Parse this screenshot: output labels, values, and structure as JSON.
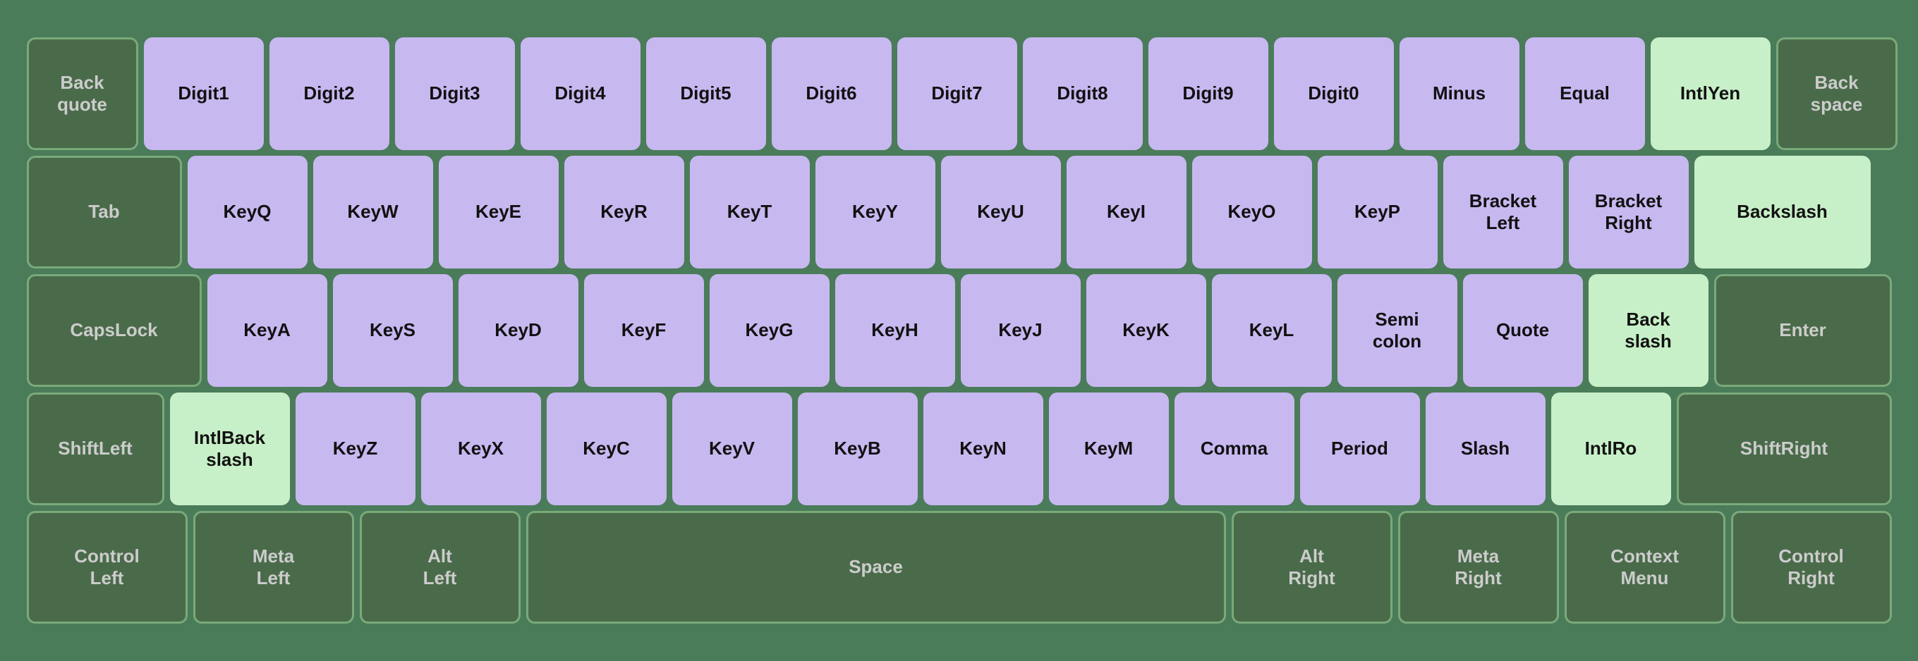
{
  "keyboard": {
    "rows": [
      {
        "id": "row1",
        "keys": [
          {
            "id": "Backquote",
            "label": "Back\nquote",
            "type": "special",
            "size": "r1-backquote"
          },
          {
            "id": "Digit1",
            "label": "Digit1",
            "type": "normal",
            "size": "r1-digit"
          },
          {
            "id": "Digit2",
            "label": "Digit2",
            "type": "normal",
            "size": "r1-digit"
          },
          {
            "id": "Digit3",
            "label": "Digit3",
            "type": "normal",
            "size": "r1-digit"
          },
          {
            "id": "Digit4",
            "label": "Digit4",
            "type": "normal",
            "size": "r1-digit"
          },
          {
            "id": "Digit5",
            "label": "Digit5",
            "type": "normal",
            "size": "r1-digit"
          },
          {
            "id": "Digit6",
            "label": "Digit6",
            "type": "normal",
            "size": "r1-digit"
          },
          {
            "id": "Digit7",
            "label": "Digit7",
            "type": "normal",
            "size": "r1-digit"
          },
          {
            "id": "Digit8",
            "label": "Digit8",
            "type": "normal",
            "size": "r1-digit"
          },
          {
            "id": "Digit9",
            "label": "Digit9",
            "type": "normal",
            "size": "r1-digit"
          },
          {
            "id": "Digit0",
            "label": "Digit0",
            "type": "normal",
            "size": "r1-digit"
          },
          {
            "id": "Minus",
            "label": "Minus",
            "type": "normal",
            "size": "r1-minus"
          },
          {
            "id": "Equal",
            "label": "Equal",
            "type": "normal",
            "size": "r1-equal"
          },
          {
            "id": "IntlYen",
            "label": "IntlYen",
            "type": "highlight",
            "size": "r1-intlyen"
          },
          {
            "id": "Backspace",
            "label": "Back\nspace",
            "type": "special",
            "size": "r1-backspace"
          }
        ]
      },
      {
        "id": "row2",
        "keys": [
          {
            "id": "Tab",
            "label": "Tab",
            "type": "special",
            "size": "r2-tab"
          },
          {
            "id": "KeyQ",
            "label": "KeyQ",
            "type": "normal",
            "size": "r2-key"
          },
          {
            "id": "KeyW",
            "label": "KeyW",
            "type": "normal",
            "size": "r2-key"
          },
          {
            "id": "KeyE",
            "label": "KeyE",
            "type": "normal",
            "size": "r2-key"
          },
          {
            "id": "KeyR",
            "label": "KeyR",
            "type": "normal",
            "size": "r2-key"
          },
          {
            "id": "KeyT",
            "label": "KeyT",
            "type": "normal",
            "size": "r2-key"
          },
          {
            "id": "KeyY",
            "label": "KeyY",
            "type": "normal",
            "size": "r2-key"
          },
          {
            "id": "KeyU",
            "label": "KeyU",
            "type": "normal",
            "size": "r2-key"
          },
          {
            "id": "KeyI",
            "label": "KeyI",
            "type": "normal",
            "size": "r2-key"
          },
          {
            "id": "KeyO",
            "label": "KeyO",
            "type": "normal",
            "size": "r2-key"
          },
          {
            "id": "KeyP",
            "label": "KeyP",
            "type": "normal",
            "size": "r2-key"
          },
          {
            "id": "BracketLeft",
            "label": "Bracket\nLeft",
            "type": "normal",
            "size": "r2-bracketleft"
          },
          {
            "id": "BracketRight",
            "label": "Bracket\nRight",
            "type": "normal",
            "size": "r2-bracketright"
          },
          {
            "id": "Backslash",
            "label": "Backslash",
            "type": "highlight",
            "size": "r2-backslash"
          }
        ]
      },
      {
        "id": "row3",
        "keys": [
          {
            "id": "CapsLock",
            "label": "CapsLock",
            "type": "special",
            "size": "r3-capslock"
          },
          {
            "id": "KeyA",
            "label": "KeyA",
            "type": "normal",
            "size": "r3-key"
          },
          {
            "id": "KeyS",
            "label": "KeyS",
            "type": "normal",
            "size": "r3-key"
          },
          {
            "id": "KeyD",
            "label": "KeyD",
            "type": "normal",
            "size": "r3-key"
          },
          {
            "id": "KeyF",
            "label": "KeyF",
            "type": "normal",
            "size": "r3-key"
          },
          {
            "id": "KeyG",
            "label": "KeyG",
            "type": "normal",
            "size": "r3-key"
          },
          {
            "id": "KeyH",
            "label": "KeyH",
            "type": "normal",
            "size": "r3-key"
          },
          {
            "id": "KeyJ",
            "label": "KeyJ",
            "type": "normal",
            "size": "r3-key"
          },
          {
            "id": "KeyK",
            "label": "KeyK",
            "type": "normal",
            "size": "r3-key"
          },
          {
            "id": "KeyL",
            "label": "KeyL",
            "type": "normal",
            "size": "r3-key"
          },
          {
            "id": "Semicolon",
            "label": "Semi\ncolon",
            "type": "normal",
            "size": "r3-semicolon"
          },
          {
            "id": "Quote",
            "label": "Quote",
            "type": "normal",
            "size": "r3-quote"
          },
          {
            "id": "Backslash2",
            "label": "Back\nslash",
            "type": "highlight",
            "size": "r3-backslash2"
          },
          {
            "id": "Enter",
            "label": "Enter",
            "type": "special",
            "size": "r3-enter"
          }
        ]
      },
      {
        "id": "row4",
        "keys": [
          {
            "id": "ShiftLeft",
            "label": "ShiftLeft",
            "type": "special",
            "size": "r4-shiftleft"
          },
          {
            "id": "IntlBackslash",
            "label": "IntlBack\nslash",
            "type": "highlight",
            "size": "r4-intlback"
          },
          {
            "id": "KeyZ",
            "label": "KeyZ",
            "type": "normal",
            "size": "r4-key"
          },
          {
            "id": "KeyX",
            "label": "KeyX",
            "type": "normal",
            "size": "r4-key"
          },
          {
            "id": "KeyC",
            "label": "KeyC",
            "type": "normal",
            "size": "r4-key"
          },
          {
            "id": "KeyV",
            "label": "KeyV",
            "type": "normal",
            "size": "r4-key"
          },
          {
            "id": "KeyB",
            "label": "KeyB",
            "type": "normal",
            "size": "r4-key"
          },
          {
            "id": "KeyN",
            "label": "KeyN",
            "type": "normal",
            "size": "r4-key"
          },
          {
            "id": "KeyM",
            "label": "KeyM",
            "type": "normal",
            "size": "r4-key"
          },
          {
            "id": "Comma",
            "label": "Comma",
            "type": "normal",
            "size": "r4-key"
          },
          {
            "id": "Period",
            "label": "Period",
            "type": "normal",
            "size": "r4-key"
          },
          {
            "id": "Slash",
            "label": "Slash",
            "type": "normal",
            "size": "r4-key"
          },
          {
            "id": "IntlRo",
            "label": "IntlRo",
            "type": "highlight",
            "size": "r4-intlro"
          },
          {
            "id": "ShiftRight",
            "label": "ShiftRight",
            "type": "special",
            "size": "r4-shiftright"
          }
        ]
      },
      {
        "id": "row5",
        "keys": [
          {
            "id": "ControlLeft",
            "label": "Control\nLeft",
            "type": "special",
            "size": "r5-controlleft"
          },
          {
            "id": "MetaLeft",
            "label": "Meta\nLeft",
            "type": "special",
            "size": "r5-metaleft"
          },
          {
            "id": "AltLeft",
            "label": "Alt\nLeft",
            "type": "special",
            "size": "r5-altleft"
          },
          {
            "id": "Space",
            "label": "Space",
            "type": "special",
            "size": "r5-space"
          },
          {
            "id": "AltRight",
            "label": "Alt\nRight",
            "type": "special",
            "size": "r5-altright"
          },
          {
            "id": "MetaRight",
            "label": "Meta\nRight",
            "type": "special",
            "size": "r5-metaright"
          },
          {
            "id": "ContextMenu",
            "label": "Context\nMenu",
            "type": "special",
            "size": "r5-contextmenu"
          },
          {
            "id": "ControlRight",
            "label": "Control\nRight",
            "type": "special",
            "size": "r5-controlright"
          }
        ]
      }
    ]
  }
}
